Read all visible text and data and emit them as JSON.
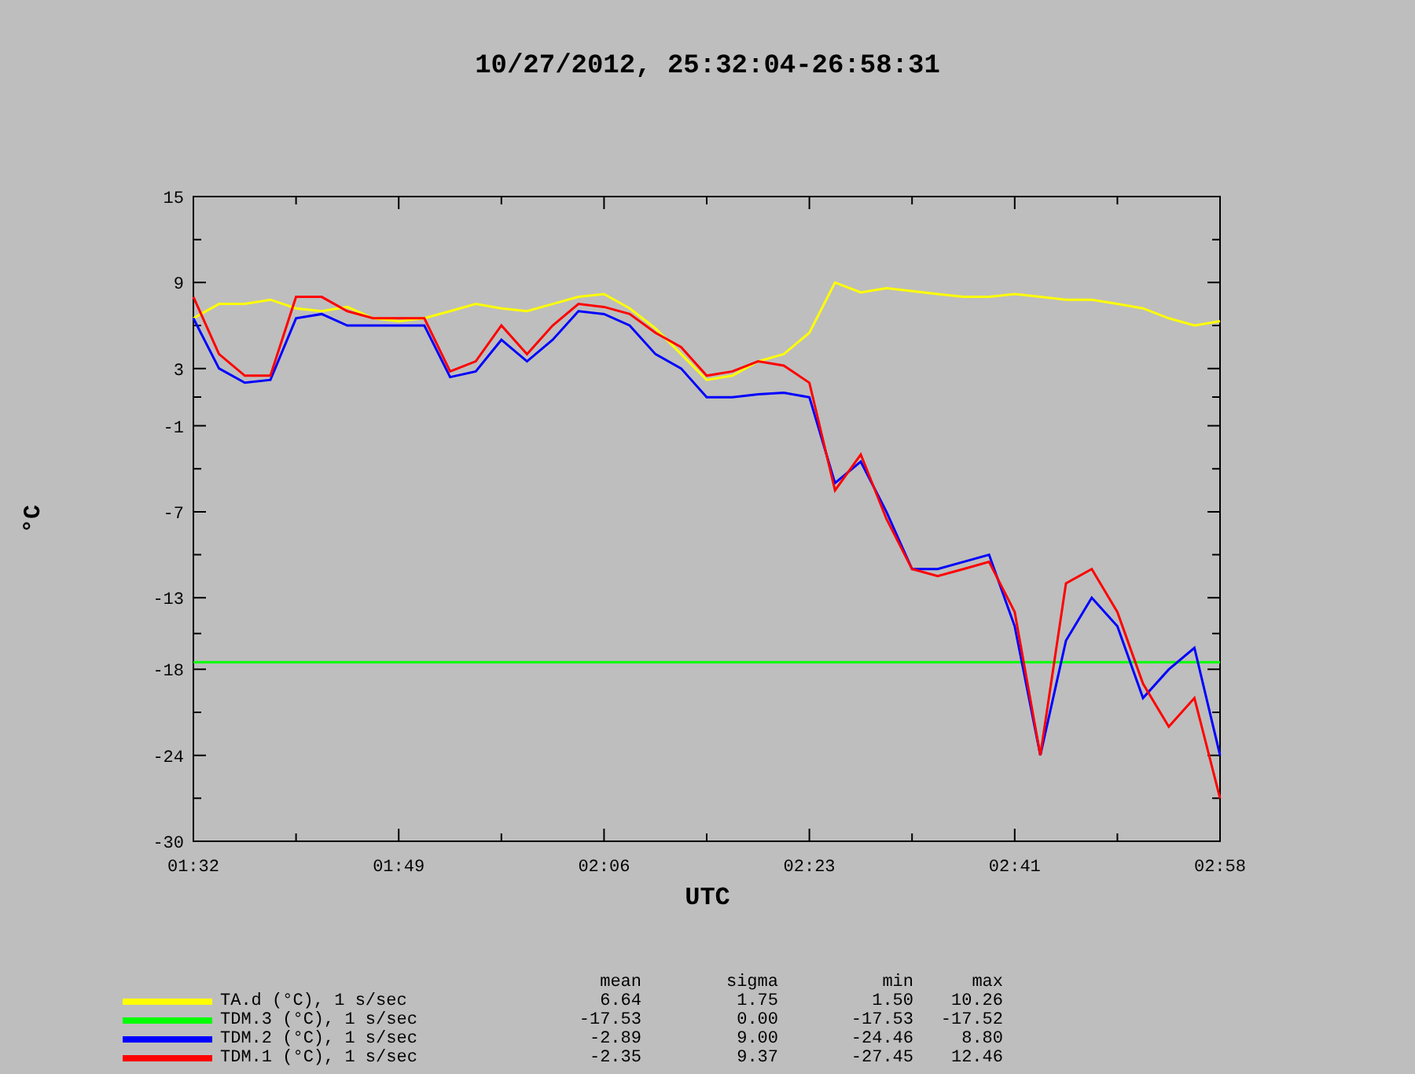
{
  "chart_data": {
    "type": "line",
    "title": "10/27/2012, 25:32:04-26:58:31",
    "xlabel": "UTC",
    "ylabel": "°C",
    "categories": [
      "01:32",
      null,
      null,
      null,
      null,
      null,
      null,
      null,
      "01:49",
      null,
      null,
      null,
      null,
      null,
      null,
      null,
      "02:06",
      null,
      null,
      null,
      null,
      null,
      null,
      null,
      "02:23",
      null,
      null,
      null,
      null,
      null,
      null,
      null,
      "02:41",
      null,
      null,
      null,
      null,
      null,
      null,
      null,
      "02:58"
    ],
    "series": [
      {
        "name": "TA.d",
        "color": "#ffff00",
        "values": [
          6.5,
          7.5,
          7.5,
          7.8,
          7.2,
          7,
          7.3,
          6.5,
          6.3,
          6.5,
          7,
          7.5,
          7.2,
          7,
          7.5,
          8,
          8.2,
          7.2,
          5.8,
          4,
          2.2,
          2.5,
          3.5,
          4,
          5.5,
          9,
          8.3,
          8.6,
          8.4,
          8.2,
          8,
          8,
          8.2,
          8,
          7.8,
          7.8,
          7.5,
          7.2,
          6.5,
          6,
          6.3
        ]
      },
      {
        "name": "TDM.3",
        "color": "#00ff00",
        "values": [
          -17.5,
          -17.5,
          -17.5,
          -17.5,
          -17.5,
          -17.5,
          -17.5,
          -17.5,
          -17.5,
          -17.5,
          -17.5,
          -17.5,
          -17.5,
          -17.5,
          -17.5,
          -17.5,
          -17.5,
          -17.5,
          -17.5,
          -17.5,
          -17.5,
          -17.5,
          -17.5,
          -17.5,
          -17.5,
          -17.5,
          -17.5,
          -17.5,
          -17.5,
          -17.5,
          -17.5,
          -17.5,
          -17.5,
          -17.5,
          -17.5,
          -17.5,
          -17.5,
          -17.5,
          -17.5,
          -17.5,
          -17.5
        ]
      },
      {
        "name": "TDM.2",
        "color": "#0000ff",
        "values": [
          6.5,
          3,
          2,
          2.2,
          6.5,
          6.8,
          6,
          6,
          6,
          6,
          2.4,
          2.8,
          5,
          3.5,
          5,
          7,
          6.8,
          6,
          4,
          3,
          1,
          1,
          1.2,
          1.3,
          1,
          -5,
          -3.5,
          -7,
          -11,
          -11,
          -10.5,
          -10,
          -15,
          -24,
          -16,
          -13,
          -15,
          -20,
          -18,
          -16.5,
          -24
        ]
      },
      {
        "name": "TDM.1",
        "color": "#ff0000",
        "values": [
          8,
          4,
          2.5,
          2.5,
          8,
          8,
          7,
          6.5,
          6.5,
          6.5,
          2.8,
          3.5,
          6,
          4,
          6,
          7.5,
          7.3,
          6.8,
          5.5,
          4.5,
          2.5,
          2.8,
          3.5,
          3.2,
          2,
          -5.5,
          -3,
          -7.5,
          -11,
          -11.5,
          -11,
          -10.5,
          -14,
          -24,
          -12,
          -11,
          -14,
          -19,
          -22,
          -20,
          -27
        ]
      }
    ],
    "ylim": [
      -30,
      15
    ],
    "yticks": [
      15,
      9,
      3,
      -1,
      -7,
      -13,
      -18,
      -24,
      -30
    ]
  },
  "legend": {
    "columns": [
      "mean",
      "sigma",
      "min",
      "max"
    ],
    "rows": [
      {
        "suffix": " (°C), 1 s/sec",
        "values": [
          "6.64",
          "1.75",
          "1.50",
          "10.26"
        ]
      },
      {
        "suffix": " (°C), 1 s/sec",
        "values": [
          "-17.53",
          "0.00",
          "-17.53",
          "-17.52"
        ]
      },
      {
        "suffix": " (°C), 1 s/sec",
        "values": [
          "-2.89",
          "9.00",
          "-24.46",
          "8.80"
        ]
      },
      {
        "suffix": " (°C), 1 s/sec",
        "values": [
          "-2.35",
          "9.37",
          "-27.45",
          "12.46"
        ]
      }
    ]
  }
}
